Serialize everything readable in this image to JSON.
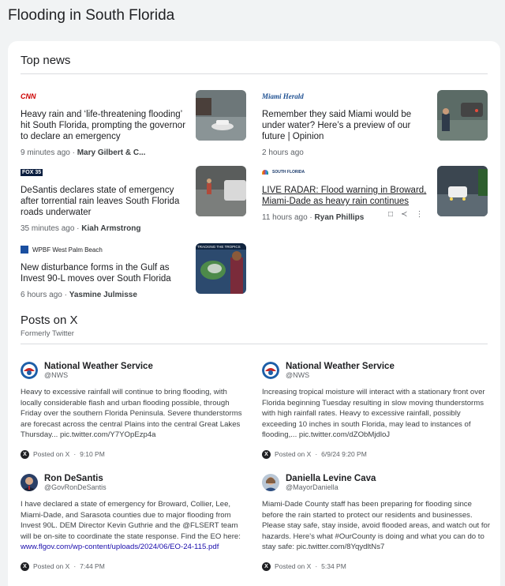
{
  "page": {
    "title": "Flooding in South Florida"
  },
  "top_news": {
    "title": "Top news",
    "items": [
      {
        "source": "CNN",
        "headline": "Heavy rain and ‘life-threatening flooding’ hit South Florida, prompting the governor to declare an emergency",
        "time": "9 minutes ago",
        "author": "Mary Gilbert & C..."
      },
      {
        "source": "Miami Herald",
        "headline": "Remember they said Miami would be under water? Here’s a preview of our future | Opinion",
        "time": "2 hours ago",
        "author": ""
      },
      {
        "source": "FOX 35",
        "headline": "DeSantis declares state of emergency after torrential rain leaves South Florida roads underwater",
        "time": "35 minutes ago",
        "author": "Kiah Armstrong"
      },
      {
        "source": "SOUTH FLORIDA",
        "headline": "LIVE RADAR: Flood warning in Broward, Miami-Dade as heavy rain continues",
        "time": "11 hours ago",
        "author": "Ryan Phillips"
      },
      {
        "source": "WPBF West Palm Beach",
        "headline": "New disturbance forms in the Gulf as Invest 90-L moves over South Florida",
        "time": "6 hours ago",
        "author": "Yasmine Julmisse",
        "thumb_caption": "TRACKING THE TROPICS"
      }
    ]
  },
  "posts": {
    "title": "Posts on X",
    "subtitle": "Formerly Twitter",
    "items": [
      {
        "name": "National Weather Service",
        "handle": "@NWS",
        "text": "Heavy to excessive rainfall will continue to bring flooding, with locally considerable flash and urban flooding possible, through Friday over the southern Florida Peninsula. Severe thunderstorms are forecast across the central Plains into the central Great Lakes Thursday... pic.twitter.com/Y7YOpEzp4a",
        "posted": "Posted on X",
        "time": "9:10 PM"
      },
      {
        "name": "National Weather Service",
        "handle": "@NWS",
        "text": "Increasing tropical moisture will interact with a stationary front over Florida beginning Tuesday resulting in slow moving thunderstorms with high rainfall rates. Heavy to excessive rainfall, possibly exceeding 10 inches in south Florida, may lead to instances of flooding,... pic.twitter.com/dZObMjdloJ",
        "posted": "Posted on X",
        "time": "6/9/24 9:20 PM"
      },
      {
        "name": "Ron DeSantis",
        "handle": "@GovRonDeSantis",
        "text": "I have declared a state of emergency for Broward, Collier, Lee, Miami-Dade, and Sarasota counties due to major flooding from Invest 90L. DEM Director Kevin Guthrie and the @FLSERT team will be on-site to coordinate the state response. Find the EO here: ",
        "link": "www.flgov.com/wp-content/uploads/2024/06/EO-24-115.pdf",
        "posted": "Posted on X",
        "time": "7:44 PM"
      },
      {
        "name": "Daniella Levine Cava",
        "handle": "@MayorDaniella",
        "text": "Miami-Dade County staff has been preparing for flooding since before the rain started to protect our residents and businesses. Please stay safe, stay inside, avoid flooded areas, and watch out for hazards. Here's what #OurCounty is doing and what you can do to stay safe: pic.twitter.com/8YqydltNs7",
        "posted": "Posted on X",
        "time": "5:34 PM"
      }
    ]
  },
  "icons": {
    "bookmark": "bookmark-icon",
    "share": "share-icon",
    "more": "more-icon"
  }
}
